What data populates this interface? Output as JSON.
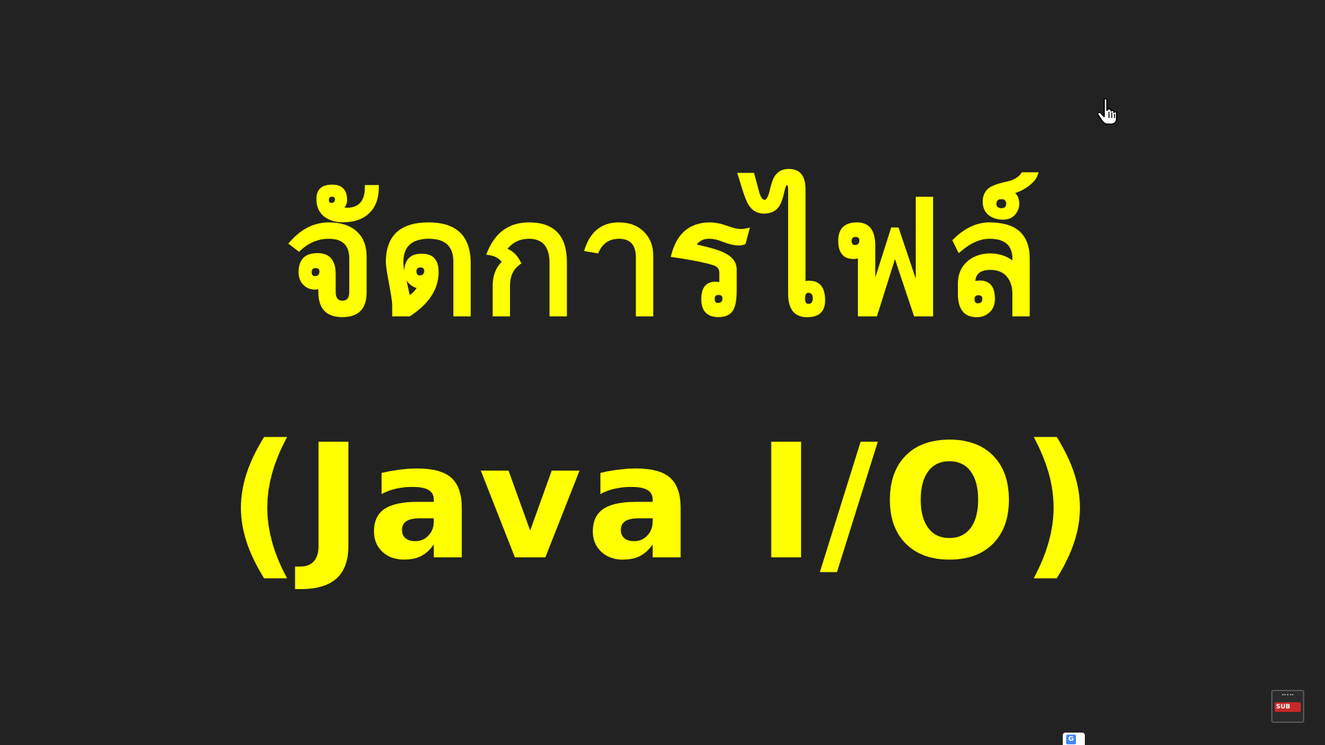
{
  "slide": {
    "background": "#222222",
    "accent_color": "#FFFF00",
    "title_line_1": "จัดการไฟล์",
    "title_line_2": "(Java I/O)"
  },
  "overlays": {
    "cursor_icon": "hand-pointer-icon",
    "translate_icon": "google-translate-icon",
    "translate_glyph": "G",
    "subtitle_icon": "subtitle-extension-icon",
    "subtitle_label": "SUB"
  }
}
